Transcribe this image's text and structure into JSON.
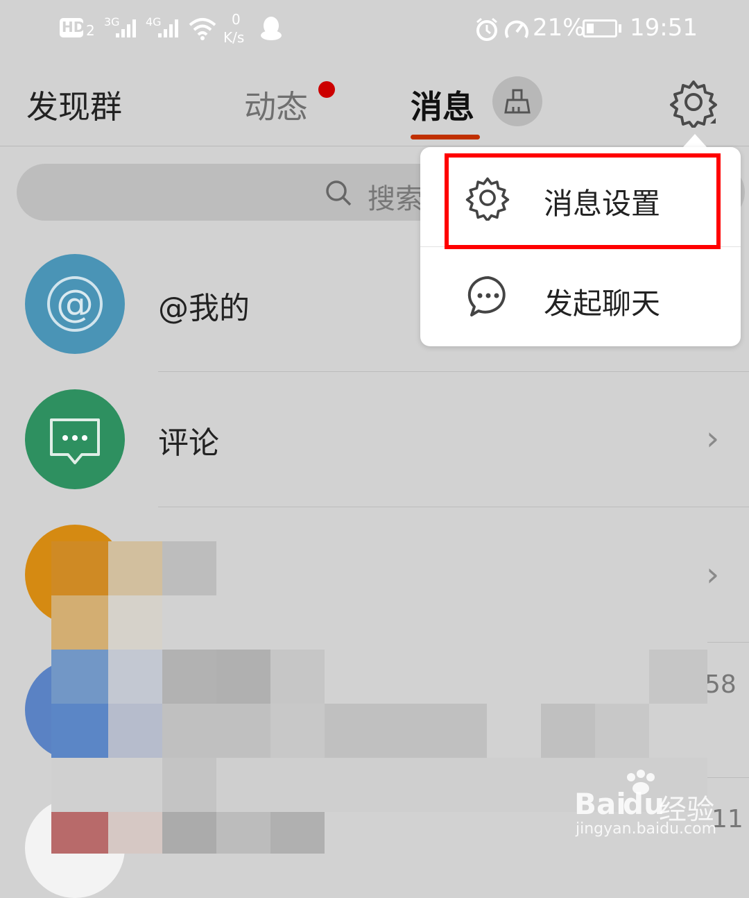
{
  "status_bar": {
    "hd": "HD",
    "hd_sub": "2",
    "net3g": "3G",
    "net4g": "4G",
    "speed_value": "0",
    "speed_unit": "K/s",
    "battery": "21%",
    "time": "19:51"
  },
  "tabs": [
    {
      "label": "发现群"
    },
    {
      "label": "动态",
      "has_dot": true
    },
    {
      "label": "消息",
      "active": true
    }
  ],
  "search": {
    "placeholder": "搜索"
  },
  "rows": [
    {
      "label": "@我的",
      "color": "#4a94b6"
    },
    {
      "label": "评论",
      "color": "#2e9060"
    }
  ],
  "partial_values": {
    "row4_value": "58",
    "row5_value": "11"
  },
  "popup_menu": {
    "items": [
      {
        "label": "消息设置",
        "icon": "gear-icon"
      },
      {
        "label": "发起聊天",
        "icon": "chat-bubble-icon"
      }
    ]
  },
  "watermark": {
    "brand": "Bai",
    "brand2": "du",
    "suffix": "经验",
    "url": "jingyan.baidu.com"
  },
  "colors": {
    "accent": "#c03000",
    "highlight": "#ff0000",
    "notify_dot": "#cc0000"
  }
}
